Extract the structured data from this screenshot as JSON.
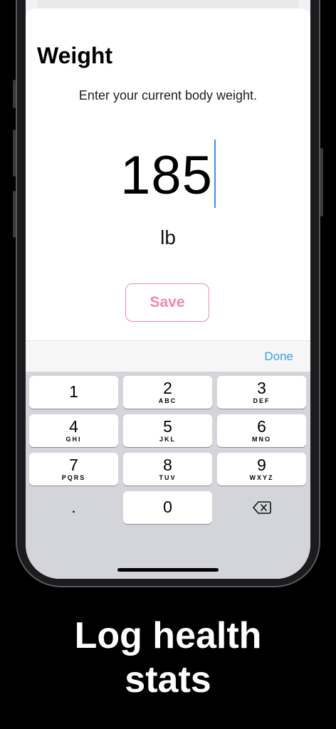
{
  "screen": {
    "title": "Weight",
    "subtitle": "Enter your current body weight.",
    "value": "185",
    "unit": "lb",
    "save_label": "Save"
  },
  "toolbar": {
    "done_label": "Done"
  },
  "keypad": {
    "keys": [
      {
        "digit": "1",
        "letters": ""
      },
      {
        "digit": "2",
        "letters": "ABC"
      },
      {
        "digit": "3",
        "letters": "DEF"
      },
      {
        "digit": "4",
        "letters": "GHI"
      },
      {
        "digit": "5",
        "letters": "JKL"
      },
      {
        "digit": "6",
        "letters": "MNO"
      },
      {
        "digit": "7",
        "letters": "PQRS"
      },
      {
        "digit": "8",
        "letters": "TUV"
      },
      {
        "digit": "9",
        "letters": "WXYZ"
      },
      {
        "digit": ".",
        "letters": ""
      },
      {
        "digit": "0",
        "letters": ""
      },
      {
        "digit": "⌫",
        "letters": ""
      }
    ]
  },
  "caption": {
    "line1": "Log health",
    "line2": "stats"
  },
  "colors": {
    "accent_pink": "#f08aa6",
    "link_blue": "#3a9ee6",
    "caret": "#3b8fe6"
  }
}
